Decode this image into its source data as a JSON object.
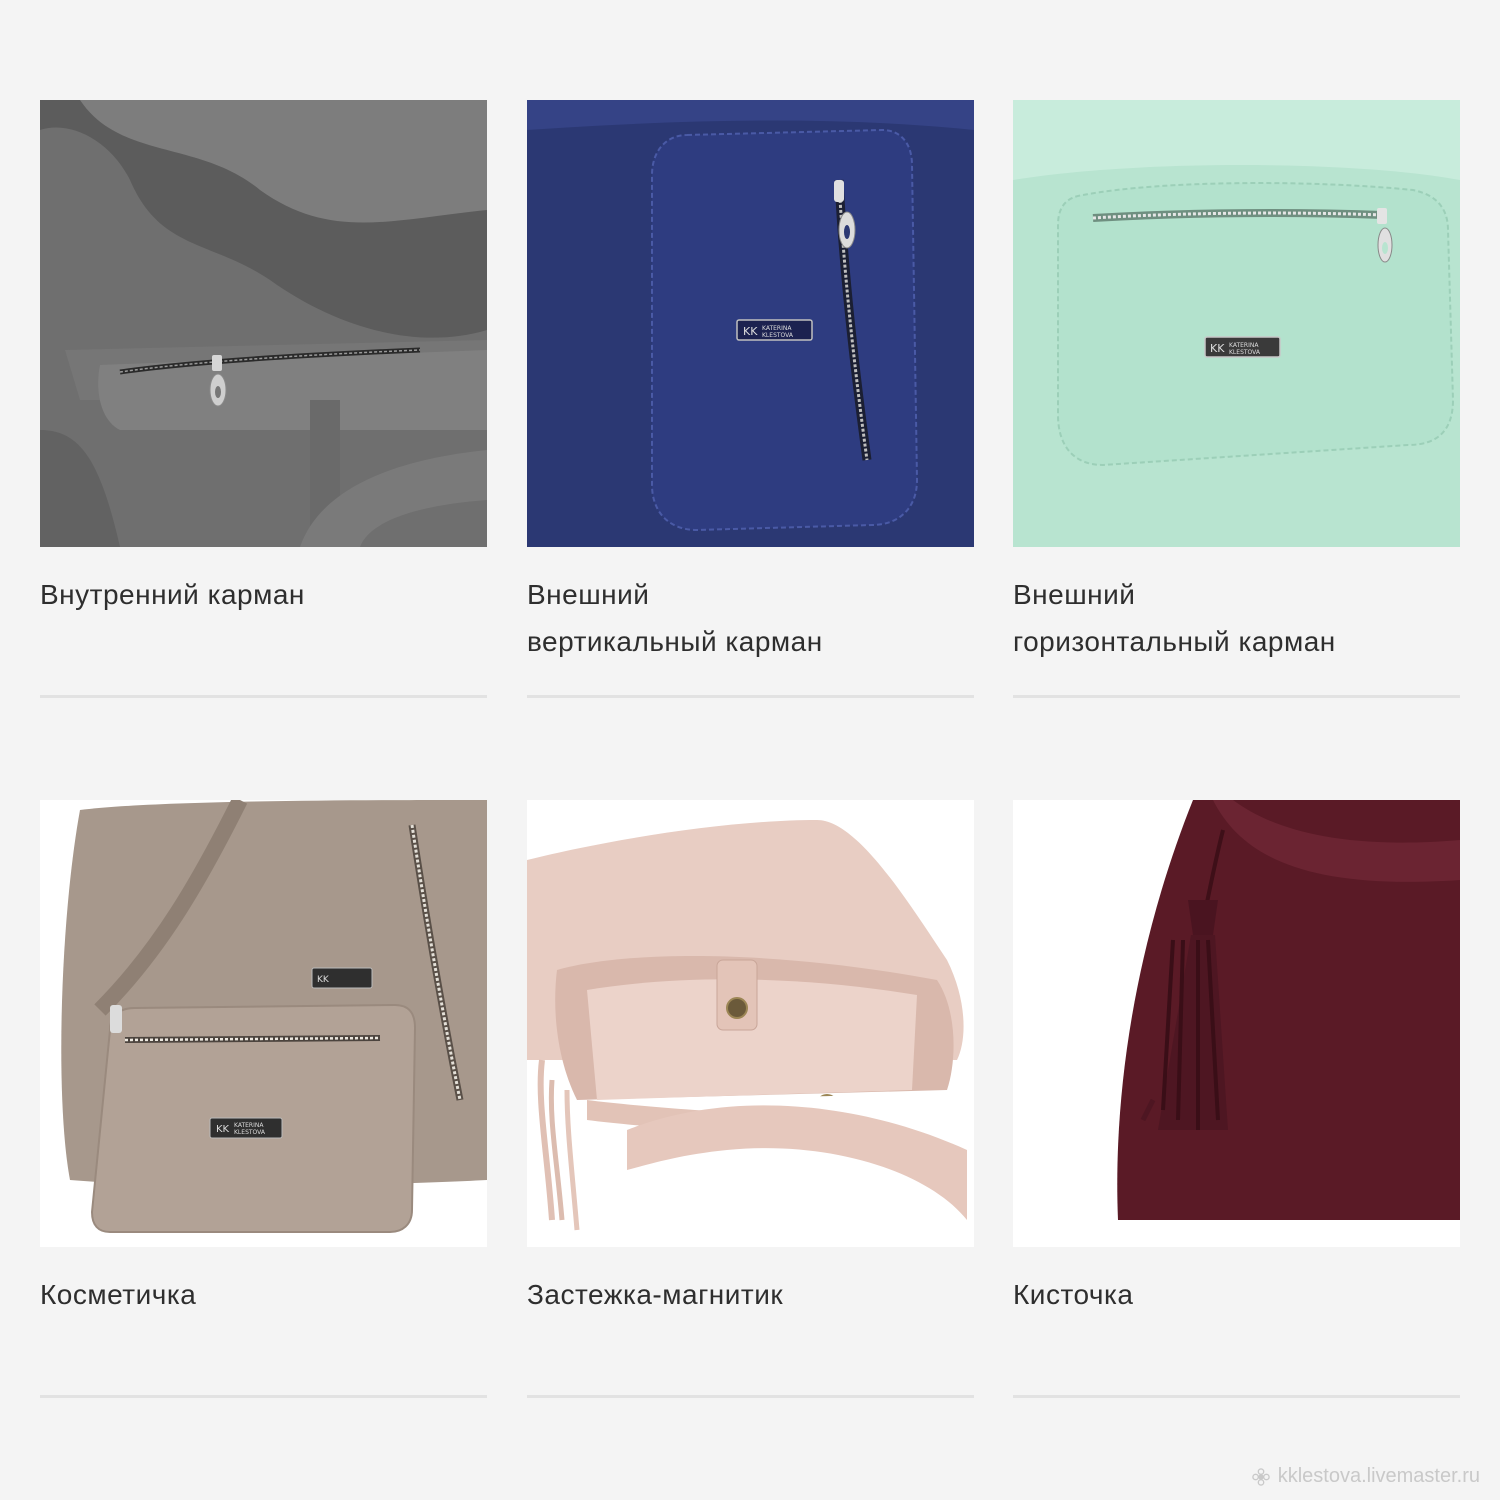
{
  "items": [
    {
      "caption_line1": "Внутренний карман",
      "caption_line2": "",
      "photo": "inner-pocket",
      "color": "#6e6e6e"
    },
    {
      "caption_line1": "Внешний",
      "caption_line2": "вертикальный карман",
      "photo": "vertical-pocket",
      "color": "#2a3a78"
    },
    {
      "caption_line1": "Внешний",
      "caption_line2": "горизонтальный карман",
      "photo": "horizontal-pocket",
      "color": "#b9e6d3"
    },
    {
      "caption_line1": "Косметичка",
      "caption_line2": "",
      "photo": "cosmetic-bag",
      "color": "#a6978c"
    },
    {
      "caption_line1": "Застежка-магнитик",
      "caption_line2": "",
      "photo": "magnetic-clasp",
      "color": "#e8c9c0"
    },
    {
      "caption_line1": "Кисточка",
      "caption_line2": "",
      "photo": "tassel",
      "color": "#5a1a26"
    }
  ],
  "logo_text": {
    "line1": "KATERINA",
    "line2": "KLESTOVA",
    "monogram": "KK"
  },
  "watermark": {
    "text": "kklestova.livemaster.ru",
    "icon": "flower-icon"
  }
}
